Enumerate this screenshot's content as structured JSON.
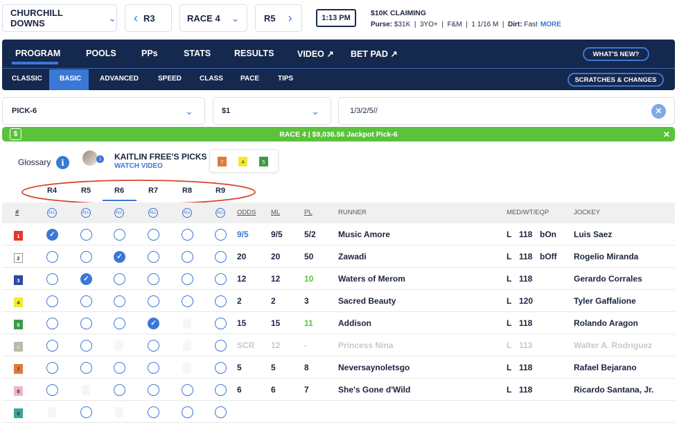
{
  "top": {
    "track": "CHURCHILL DOWNS",
    "prev": "R3",
    "race": "RACE 4",
    "next": "R5",
    "post_time": "1:13 PM",
    "race_title": "$10K CLAIMING",
    "purse_label": "Purse:",
    "purse": "$31K",
    "age": "3YO+",
    "sex": "F&M",
    "distance": "1 1/16 M",
    "surface_label": "Dirt:",
    "surface": "Fast",
    "more": "MORE"
  },
  "nav": {
    "tabs": [
      "PROGRAM",
      "POOLS",
      "PPs",
      "STATS",
      "RESULTS",
      "VIDEO ↗",
      "BET PAD ↗"
    ],
    "active": "PROGRAM",
    "whats_new": "WHAT'S NEW?",
    "subtabs": [
      "CLASSIC",
      "BASIC",
      "ADVANCED",
      "SPEED",
      "CLASS",
      "PACE",
      "TIPS"
    ],
    "active_sub": "BASIC",
    "scratches": "SCRATCHES & CHANGES"
  },
  "bet": {
    "type": "PICK-6",
    "amount": "$1",
    "selection": "1/3/2/5//"
  },
  "banner": "RACE 4 | $9,036.56 Jackpot Pick-6",
  "glossary": "Glossary",
  "picks": {
    "title": "KAITLIN FREE'S PICKS",
    "watch": "WATCH VIDEO",
    "numbers": [
      {
        "n": "7",
        "color": "#e07a3a"
      },
      {
        "n": "4",
        "color": "#f2e935"
      },
      {
        "n": "5",
        "color": "#3d9a45"
      }
    ]
  },
  "race_tabs": [
    "R4",
    "R5",
    "R6",
    "R7",
    "R8",
    "R9"
  ],
  "active_race_tab": "R6",
  "table": {
    "headers": {
      "num": "#",
      "all": "ALL",
      "odds": "ODDS",
      "ml": "ML",
      "pl": "PL",
      "runner": "RUNNER",
      "med": "MED/WT/EQP",
      "jockey": "JOCKEY"
    },
    "rows": [
      {
        "num": "1",
        "color": "#e4362a",
        "text": "#fff",
        "picks": [
          "check",
          "open",
          "open",
          "open",
          "open",
          "open"
        ],
        "odds": "9/5",
        "odds_blue": true,
        "ml": "9/5",
        "pl": "5/2",
        "runner": "Music Amore",
        "med": "L",
        "wt": "118",
        "eqp": "bOn",
        "jockey": "Luis Saez"
      },
      {
        "num": "2",
        "color": "#ffffff",
        "text": "#333",
        "picks": [
          "open",
          "open",
          "check",
          "open",
          "open",
          "open"
        ],
        "odds": "20",
        "ml": "20",
        "pl": "50",
        "runner": "Zawadi",
        "med": "L",
        "wt": "118",
        "eqp": "bOff",
        "jockey": "Rogelio Miranda"
      },
      {
        "num": "3",
        "color": "#2d48a8",
        "text": "#fff",
        "picks": [
          "open",
          "check",
          "open",
          "open",
          "open",
          "open"
        ],
        "odds": "12",
        "ml": "12",
        "pl": "10",
        "pl_green": true,
        "runner": "Waters of Merom",
        "med": "L",
        "wt": "118",
        "eqp": "",
        "jockey": "Gerardo Corrales"
      },
      {
        "num": "4",
        "color": "#f2e935",
        "text": "#333",
        "picks": [
          "open",
          "open",
          "open",
          "open",
          "open",
          "open"
        ],
        "odds": "2",
        "ml": "2",
        "pl": "3",
        "runner": "Sacred Beauty",
        "med": "L",
        "wt": "120",
        "eqp": "",
        "jockey": "Tyler Gaffalione"
      },
      {
        "num": "5",
        "color": "#3d9a45",
        "text": "#fff",
        "picks": [
          "open",
          "open",
          "open",
          "check",
          "none",
          "open"
        ],
        "odds": "15",
        "ml": "15",
        "pl": "11",
        "pl_green": true,
        "runner": "Addison",
        "med": "L",
        "wt": "118",
        "eqp": "",
        "jockey": "Rolando Aragon"
      },
      {
        "num": "6",
        "color": "#b8b8b8",
        "text": "#f2e935",
        "picks": [
          "open",
          "open",
          "none",
          "open",
          "none",
          "open"
        ],
        "odds": "SCR",
        "ml": "12",
        "pl": "-",
        "runner": "Princess Nina",
        "med": "L",
        "wt": "113",
        "eqp": "",
        "jockey": "Walter A. Rodriguez",
        "scratched": true
      },
      {
        "num": "7",
        "color": "#e07a3a",
        "text": "#333",
        "picks": [
          "open",
          "open",
          "open",
          "open",
          "none",
          "open"
        ],
        "odds": "5",
        "ml": "5",
        "pl": "8",
        "runner": "Neversaynoletsgo",
        "med": "L",
        "wt": "118",
        "eqp": "",
        "jockey": "Rafael Bejarano"
      },
      {
        "num": "8",
        "color": "#f0b5c4",
        "text": "#333",
        "picks": [
          "open",
          "none",
          "open",
          "open",
          "open",
          "open"
        ],
        "odds": "6",
        "ml": "6",
        "pl": "7",
        "runner": "She's Gone d'Wild",
        "med": "L",
        "wt": "118",
        "eqp": "",
        "jockey": "Ricardo Santana, Jr."
      },
      {
        "num": "9",
        "color": "#3aa39a",
        "text": "#333",
        "picks": [
          "none",
          "open",
          "none",
          "open",
          "open",
          "open"
        ],
        "odds": "",
        "ml": "",
        "pl": "",
        "runner": "",
        "med": "",
        "wt": "",
        "eqp": "",
        "jockey": ""
      }
    ]
  },
  "colors": {
    "navy": "#15284d",
    "accent": "#3a78d6",
    "green": "#5ac23b",
    "annotation": "#d9452b"
  }
}
